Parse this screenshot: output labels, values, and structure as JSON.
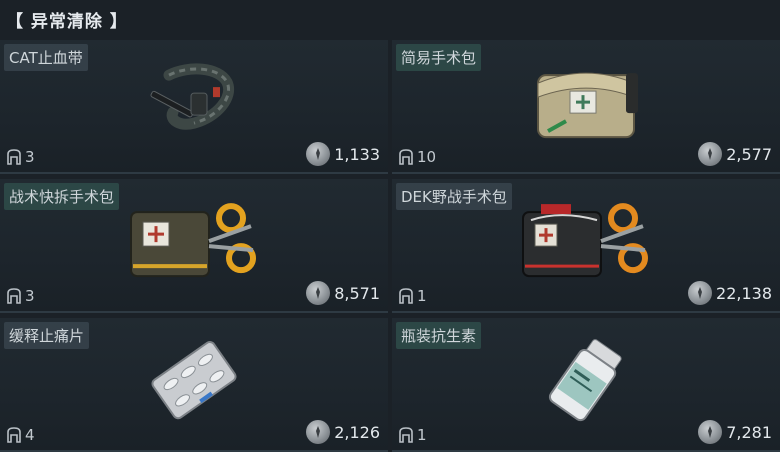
{
  "header": {
    "title": "【 异常清除 】"
  },
  "items": [
    {
      "name": "CAT止血带",
      "stack": "3",
      "price": "1,133",
      "icon": "tourniquet-icon"
    },
    {
      "name": "简易手术包",
      "stack": "10",
      "price": "2,577",
      "icon": "simple-surgical-kit-icon"
    },
    {
      "name": "战术快拆手术包",
      "stack": "3",
      "price": "8,571",
      "icon": "tactical-surgical-kit-icon"
    },
    {
      "name": "DEK野战手术包",
      "stack": "1",
      "price": "22,138",
      "icon": "dek-field-surgical-kit-icon"
    },
    {
      "name": "缓释止痛片",
      "stack": "4",
      "price": "2,126",
      "icon": "painkiller-pills-icon"
    },
    {
      "name": "瓶装抗生素",
      "stack": "1",
      "price": "7,281",
      "icon": "antibiotic-bottle-icon"
    }
  ]
}
